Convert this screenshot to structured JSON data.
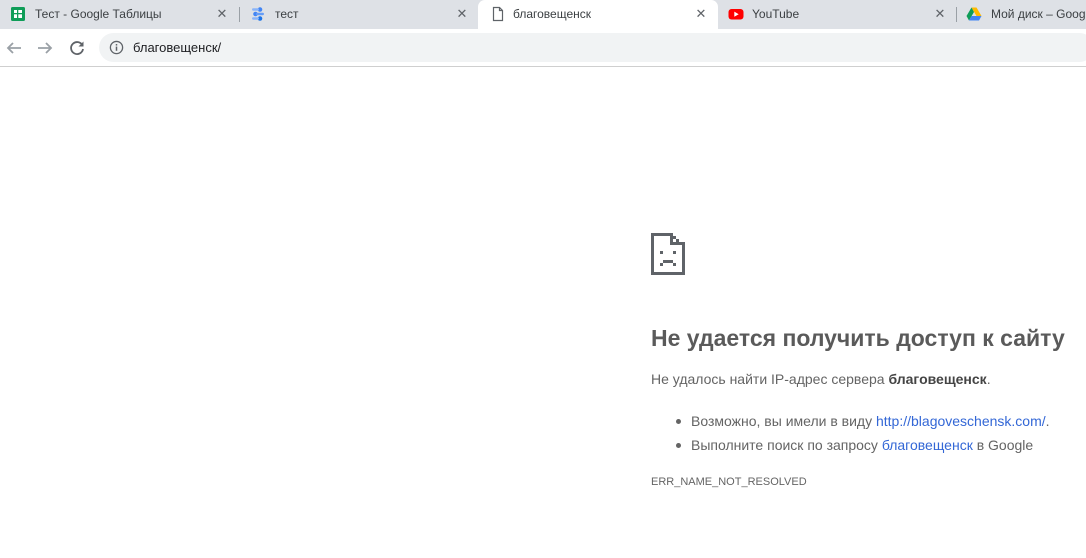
{
  "tabs": [
    {
      "title": "Тест - Google Таблицы",
      "icon": "google-sheets-icon"
    },
    {
      "title": "тест",
      "icon": "google-data-studio-icon"
    },
    {
      "title": "благовещенск",
      "icon": "page-icon"
    },
    {
      "title": "YouTube",
      "icon": "youtube-icon"
    },
    {
      "title": "Мой диск – Goog",
      "icon": "google-drive-icon"
    }
  ],
  "omnibox": {
    "url": "благовещенск/",
    "icon": "info-icon"
  },
  "error": {
    "icon": "sad-page-icon",
    "title": "Не удается получить доступ к сайту",
    "desc_prefix": "Не удалось найти IP-адрес сервера ",
    "desc_host": "благовещенск",
    "desc_suffix": ".",
    "suggestion1_prefix": "Возможно, вы имели в виду ",
    "suggestion1_link": "http://blagoveschensk.com/",
    "suggestion1_suffix": ".",
    "suggestion2_prefix": "Выполните поиск по запросу ",
    "suggestion2_link": "благовещенск",
    "suggestion2_suffix": " в Google",
    "code": "ERR_NAME_NOT_RESOLVED"
  },
  "colors": {
    "tabstrip_bg": "#dee1e6",
    "link": "#3367d6",
    "title": "#5a5a5a",
    "text": "#646464"
  }
}
